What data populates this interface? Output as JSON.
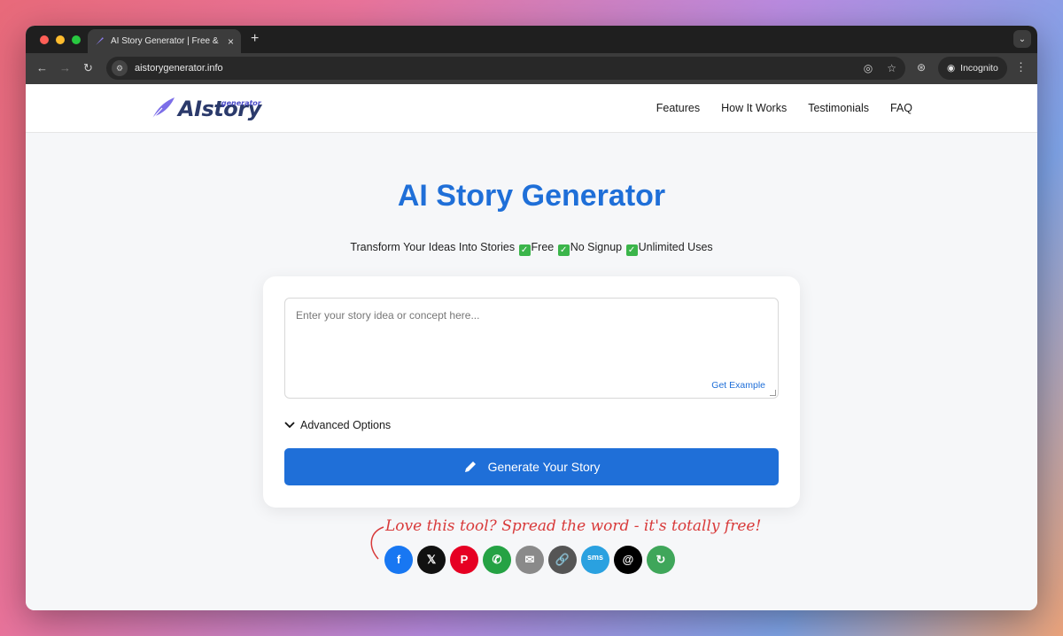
{
  "browser": {
    "tab_title": "AI Story Generator | Free & No",
    "tab_close": "×",
    "new_tab": "+",
    "tab_menu": "⌄",
    "url": "aistorygenerator.info",
    "incognito_label": "Incognito",
    "colors": {
      "close": "#ff5f57",
      "minimize": "#febc2e",
      "maximize": "#28c840"
    }
  },
  "site": {
    "logo_main": "AIstory",
    "logo_sub": "generator",
    "nav": [
      "Features",
      "How It Works",
      "Testimonials",
      "FAQ"
    ]
  },
  "hero": {
    "title": "AI Story Generator",
    "sub_text_1": "Transform Your Ideas Into Stories ",
    "free": "Free ",
    "no_signup": "No Signup ",
    "unlimited": "Unlimited Uses"
  },
  "form": {
    "placeholder": "Enter your story idea or concept here...",
    "get_example": "Get Example",
    "advanced_options": "Advanced Options",
    "generate_label": "Generate Your Story"
  },
  "share": {
    "text": "Love this tool? Spread the word - it's totally free!",
    "icons": [
      {
        "name": "facebook-icon",
        "glyph": "f",
        "color": "#1877f2"
      },
      {
        "name": "x-icon",
        "glyph": "𝕏",
        "color": "#111111"
      },
      {
        "name": "pinterest-icon",
        "glyph": "P",
        "color": "#e60023"
      },
      {
        "name": "whatsapp-icon",
        "glyph": "✆",
        "color": "#25a244"
      },
      {
        "name": "email-icon",
        "glyph": "✉",
        "color": "#8a8a8a"
      },
      {
        "name": "link-icon",
        "glyph": "🔗",
        "color": "#555555"
      },
      {
        "name": "sms-icon",
        "glyph": "sms",
        "color": "#2aa1e0"
      },
      {
        "name": "threads-icon",
        "glyph": "@",
        "color": "#000000"
      },
      {
        "name": "share-icon",
        "glyph": "↻",
        "color": "#3fa65a"
      }
    ]
  }
}
